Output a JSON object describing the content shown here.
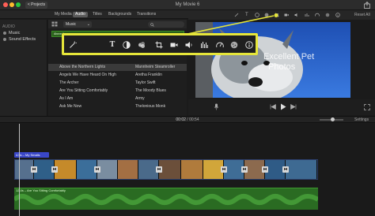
{
  "window": {
    "projects_label": "< Projects",
    "title": "My Movie 6"
  },
  "tabs": [
    "My Media",
    "Audio",
    "Titles",
    "Backgrounds",
    "Transitions"
  ],
  "active_tab": "Audio",
  "sidebar": {
    "heading": "AUDIO",
    "items": [
      {
        "label": "Music",
        "icon": "music-note-icon"
      },
      {
        "label": "Sound Effects",
        "icon": "speaker-icon"
      }
    ]
  },
  "library": {
    "source_dropdown": "Music",
    "waveform_label": "Above the...",
    "songs": [
      {
        "title": "Above the Northern Lights",
        "artist": "Mannheim Steamroller"
      },
      {
        "title": "Angels We Have Heard On High",
        "artist": "Aretha Franklin"
      },
      {
        "title": "The Archer",
        "artist": "Taylor Swift"
      },
      {
        "title": "Are You Sitting Comfortably",
        "artist": "The Moody Blues"
      },
      {
        "title": "As I Am",
        "artist": "Army"
      },
      {
        "title": "Ask Me Now",
        "artist": "Thelonious Monk"
      }
    ],
    "footer": "\"19 files are unplayable and unavailable\""
  },
  "toolbar": {
    "tools": [
      "magic-wand-icon",
      "title-t-icon",
      "color-balance-icon",
      "color-palette-icon",
      "crop-icon",
      "camera-icon",
      "volume-icon",
      "equalizer-icon",
      "speed-gauge-icon",
      "noise-reduction-icon",
      "info-icon"
    ]
  },
  "viewer": {
    "overlay_text_1": "Excellent Pet",
    "overlay_text_2": "Photos"
  },
  "timeline": {
    "timecode": "00:02",
    "duration": "/ 00:54",
    "settings_label": "Settings",
    "title_clip_label": "4.5s – My Smalls",
    "music_label": "12.4s – Are You Sitting Comfortably"
  },
  "colors": {
    "highlight": "#e6e63a",
    "music_track": "#2a6b22",
    "title_clip": "#3a47c7",
    "accent_blue": "#2e6ff2"
  }
}
